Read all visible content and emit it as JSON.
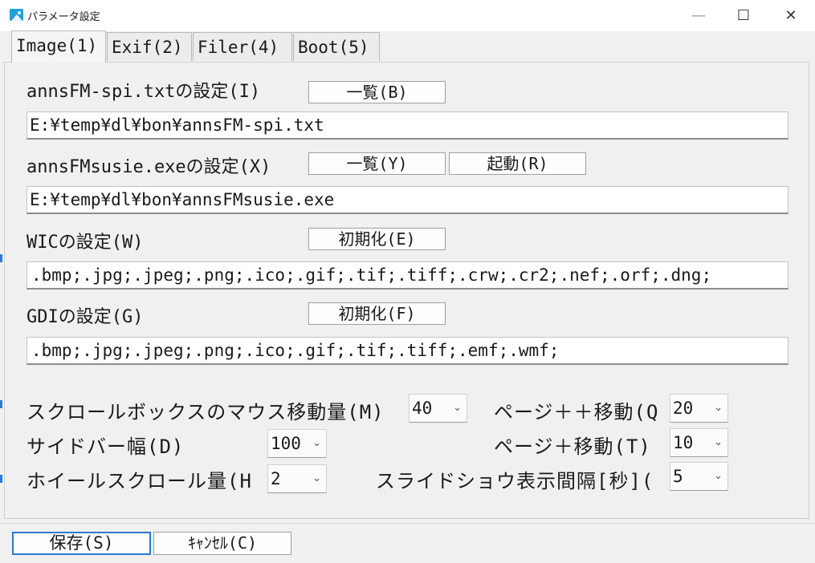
{
  "window": {
    "title": "パラメータ設定",
    "minimize": "—",
    "maximize": "☐",
    "close": "✕"
  },
  "tabs": [
    {
      "label": "Image(1)"
    },
    {
      "label": "Exif(2)"
    },
    {
      "label": "Filer(4)"
    },
    {
      "label": "Boot(5)"
    }
  ],
  "spi": {
    "label": "annsFM-spi.txtの設定(I)",
    "list_button": "一覧(B)",
    "path": "E:¥temp¥dl¥bon¥annsFM-spi.txt"
  },
  "susie": {
    "label": "annsFMsusie.exeの設定(X)",
    "list_button": "一覧(Y)",
    "launch_button": "起動(R)",
    "path": "E:¥temp¥dl¥bon¥annsFMsusie.exe"
  },
  "wic": {
    "label": "WICの設定(W)",
    "init_button": "初期化(E)",
    "extensions": ".bmp;.jpg;.jpeg;.png;.ico;.gif;.tif;.tiff;.crw;.cr2;.nef;.orf;.dng;"
  },
  "gdi": {
    "label": "GDIの設定(G)",
    "init_button": "初期化(F)",
    "extensions": ".bmp;.jpg;.jpeg;.png;.ico;.gif;.tif;.tiff;.emf;.wmf;"
  },
  "settings": {
    "scrollbox_move": {
      "label": "スクロールボックスのマウス移動量(M)",
      "value": "40"
    },
    "page_plus_plus": {
      "label": "ページ＋＋移動(Q",
      "value": "20"
    },
    "sidebar_width": {
      "label": "サイドバー幅(D)",
      "value": "100"
    },
    "page_plus": {
      "label": "ページ＋移動(T)",
      "value": "10"
    },
    "wheel_scroll": {
      "label": "ホイールスクロール量(H",
      "value": "2"
    },
    "slideshow_interval": {
      "label": "スライドショウ表示間隔[秒](",
      "value": "5"
    }
  },
  "footer": {
    "save": "保存(S)",
    "cancel": "ｷｬﾝｾﾙ(C)"
  },
  "colors": {
    "accent": "#2a7ad5",
    "background": "#f0f0f0"
  }
}
